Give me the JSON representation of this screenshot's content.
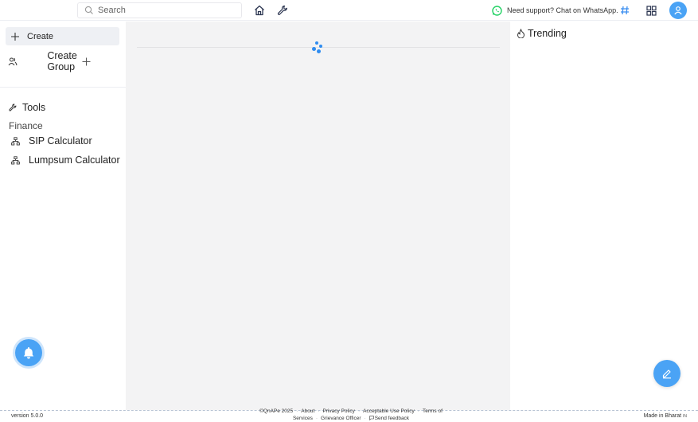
{
  "header": {
    "search_placeholder": "Search",
    "support_text": "Need support? Chat on WhatsApp.",
    "icons": [
      "search-icon",
      "home-icon",
      "wrench-icon",
      "whatsapp-icon",
      "hashtag-icon",
      "grid-icon",
      "user-icon"
    ]
  },
  "sidebar": {
    "create_label": "Create",
    "create_group_label": "Create Group",
    "tools_label": "Tools",
    "finance_label": "Finance",
    "tool_items": [
      {
        "label": "SIP Calculator"
      },
      {
        "label": "Lumpsum Calculator"
      }
    ]
  },
  "right_panel": {
    "trending_label": "Trending"
  },
  "footer": {
    "version": "version 5.0.0",
    "copyright": "©QnAPe 2025",
    "links": [
      "About",
      "Privacy Policy",
      "Acceptable Use Policy",
      "Terms of Services",
      "Grievance Officer",
      "Send feedback"
    ],
    "made_in": "Made in Bharat",
    "made_in_suffix": "IN"
  },
  "colors": {
    "accent": "#4aa3f5",
    "spinner": "#2f8cf0",
    "whatsapp": "#25d366",
    "main_bg": "#f3f3f4"
  }
}
